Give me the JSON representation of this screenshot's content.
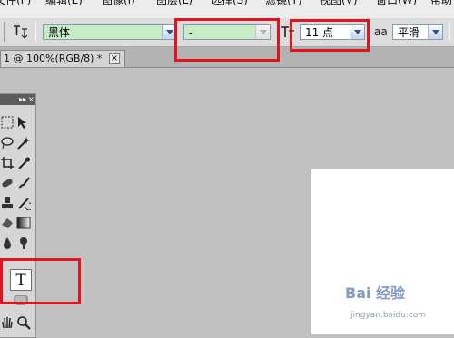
{
  "menubar": {
    "items": [
      "文件(F)",
      "编辑(E)",
      "图像(I)",
      "图层(L)",
      "选择(S)",
      "滤镜(T)",
      "视图(V)",
      "窗口(W)",
      "帮助"
    ]
  },
  "options_bar": {
    "font_family": "黑体",
    "font_style": "-",
    "font_size": "11 点",
    "antialias_glyph": "aa",
    "antialias": "平滑"
  },
  "document_tab": {
    "title": "1 @ 100%(RGB/8) *",
    "close": "×"
  },
  "toolbox": {
    "header_collapse": "▸▸",
    "header_close": "×",
    "active_tool": "T"
  },
  "watermark": {
    "logo": "Bai 经验",
    "url": "jingyan.baidu.com"
  },
  "colors": {
    "highlight_box": "#e0141c",
    "font_family_bg": "#c6ecc6",
    "canvas_bg": "#c0c0c0"
  }
}
